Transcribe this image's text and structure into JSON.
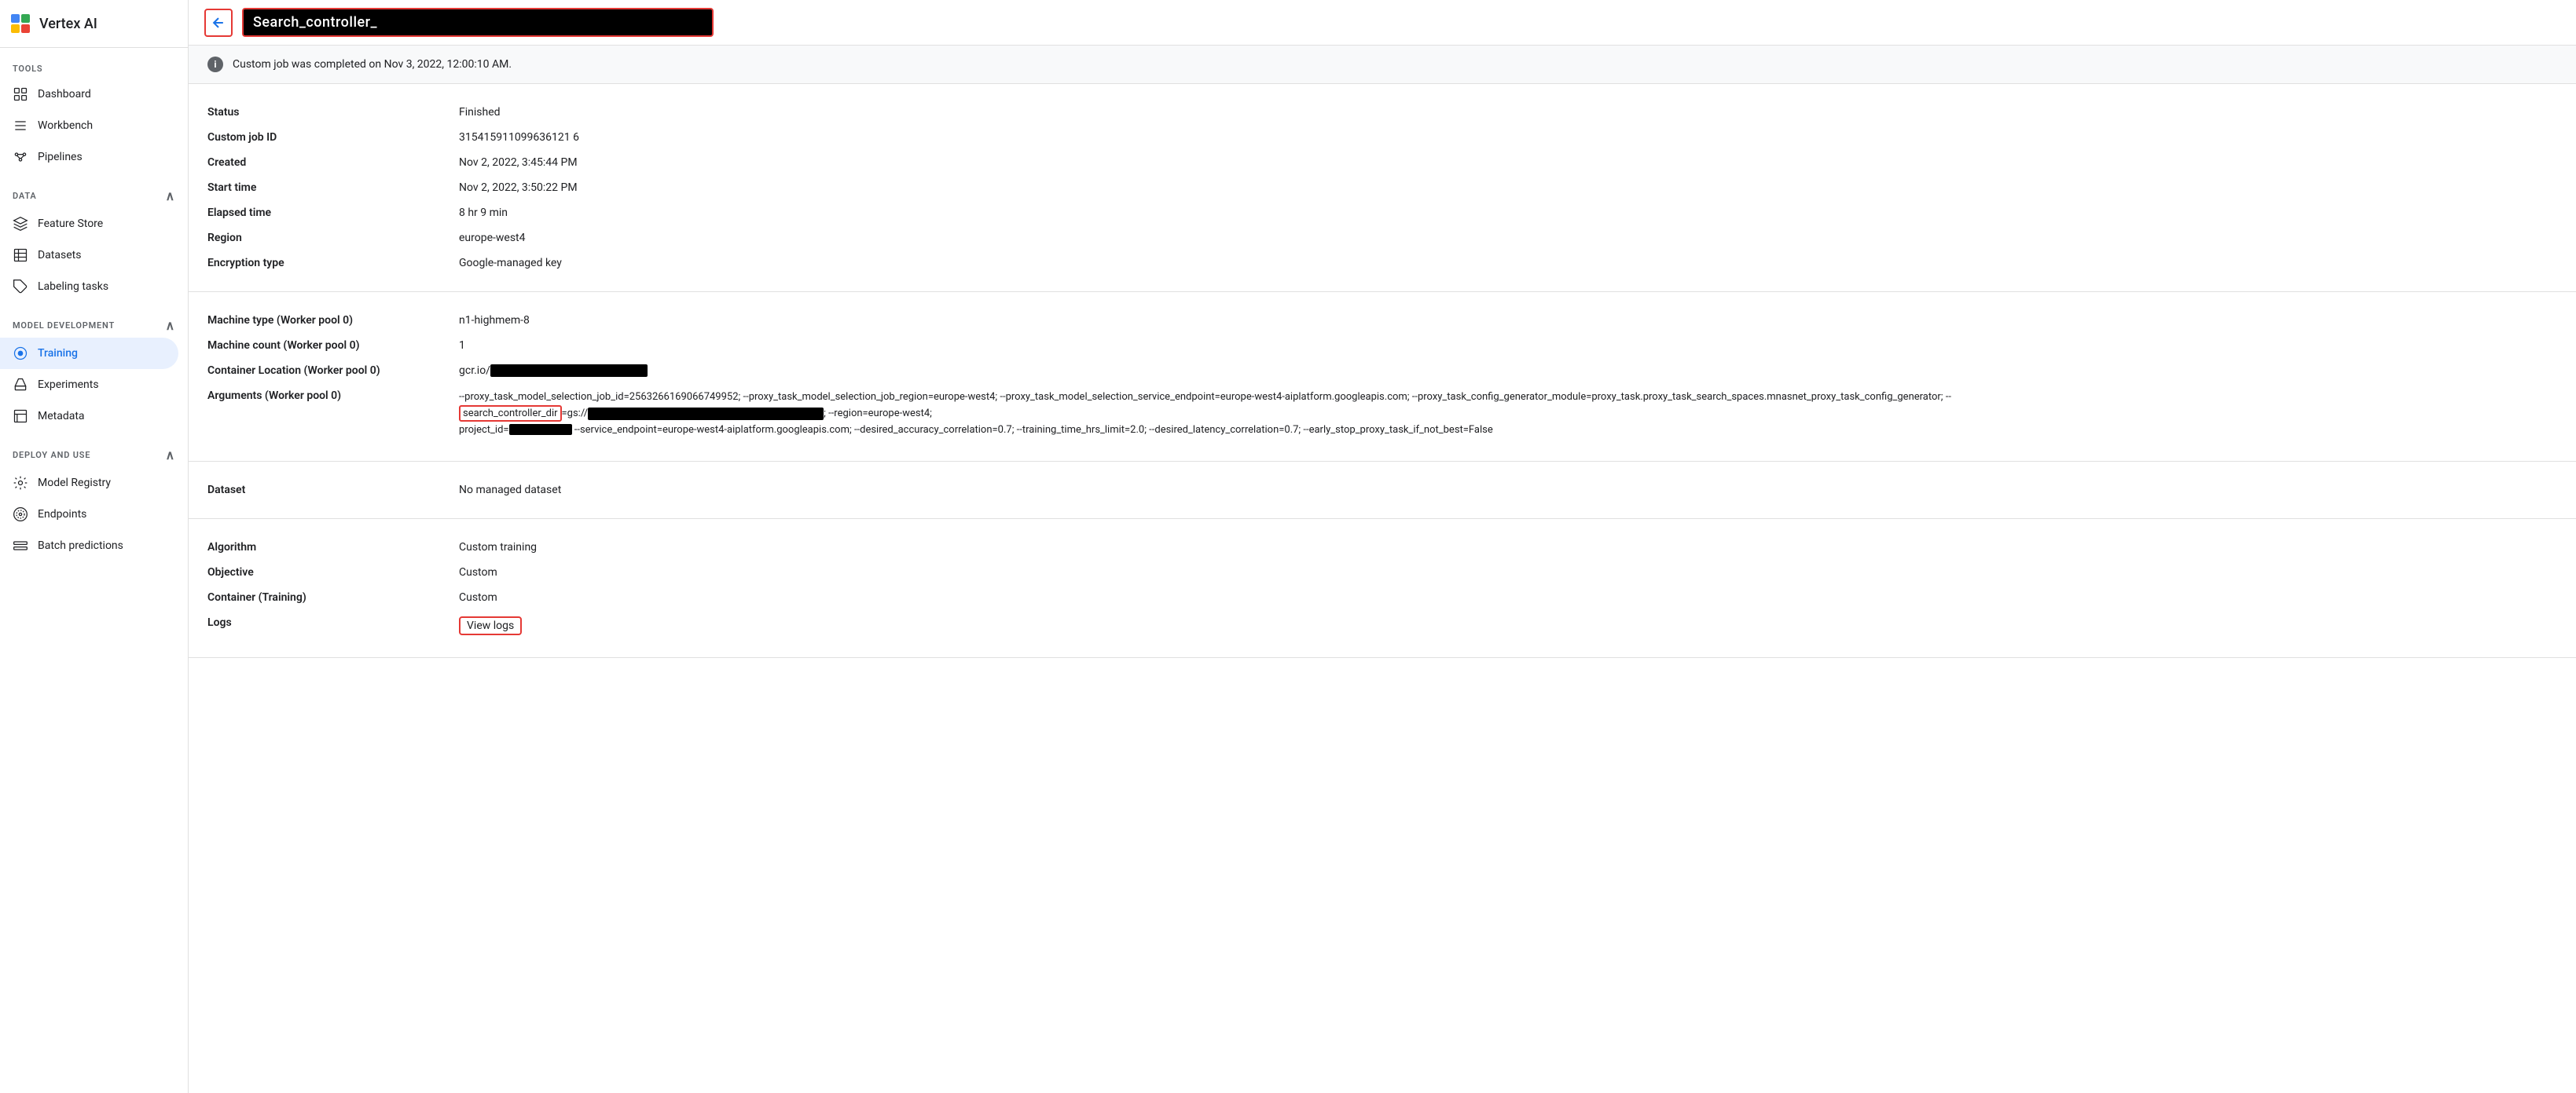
{
  "app": {
    "name": "Vertex AI"
  },
  "sidebar": {
    "tools_label": "TOOLS",
    "data_label": "DATA",
    "model_dev_label": "MODEL DEVELOPMENT",
    "deploy_label": "DEPLOY AND USE",
    "items": {
      "dashboard": "Dashboard",
      "workbench": "Workbench",
      "pipelines": "Pipelines",
      "feature_store": "Feature Store",
      "datasets": "Datasets",
      "labeling_tasks": "Labeling tasks",
      "training": "Training",
      "experiments": "Experiments",
      "metadata": "Metadata",
      "model_registry": "Model Registry",
      "endpoints": "Endpoints",
      "batch_predictions": "Batch predictions"
    }
  },
  "topbar": {
    "title": "Search_controller_",
    "back_label": "←"
  },
  "banner": {
    "message": "Custom job was completed on Nov 3, 2022, 12:00:10 AM."
  },
  "details": {
    "status_label": "Status",
    "status_value": "Finished",
    "job_id_label": "Custom job ID",
    "job_id_value": "315415911099636121 6",
    "created_label": "Created",
    "created_value": "Nov 2, 2022, 3:45:44 PM",
    "start_time_label": "Start time",
    "start_time_value": "Nov 2, 2022, 3:50:22 PM",
    "elapsed_label": "Elapsed time",
    "elapsed_value": "8 hr 9 min",
    "region_label": "Region",
    "region_value": "europe-west4",
    "encryption_label": "Encryption type",
    "encryption_value": "Google-managed key",
    "machine_type_label": "Machine type (Worker pool 0)",
    "machine_type_value": "n1-highmem-8",
    "machine_count_label": "Machine count (Worker pool 0)",
    "machine_count_value": "1",
    "container_loc_label": "Container Location (Worker pool 0)",
    "container_loc_prefix": "gcr.io/",
    "args_label": "Arguments (Worker pool 0)",
    "args_value": "--proxy_task_model_selection_job_id=2563266169066749952; --proxy_task_model_selection_job_region=europe-west4; --proxy_task_model_selection_service_endpoint=europe-west4-aiplatform.googleapis.com; --proxy_task_config_generator_module=proxy_task.proxy_task_search_spaces.mnasnet_proxy_task_config_generator; --",
    "args_highlighted": "search_controller_dir",
    "args_suffix": "=gs://",
    "args_line2": "; --region=europe-west4;",
    "args_line3": "project_id=",
    "args_line4": " --service_endpoint=europe-west4-aiplatform.googleapis.com; --desired_accuracy_correlation=0.7; --training_time_hrs_limit=2.0; --desired_latency_correlation=0.7; --early_stop_proxy_task_if_not_best=False",
    "dataset_label": "Dataset",
    "dataset_value": "No managed dataset",
    "algorithm_label": "Algorithm",
    "algorithm_value": "Custom training",
    "objective_label": "Objective",
    "objective_value": "Custom",
    "container_training_label": "Container (Training)",
    "container_training_value": "Custom",
    "logs_label": "Logs",
    "logs_link": "View logs"
  }
}
